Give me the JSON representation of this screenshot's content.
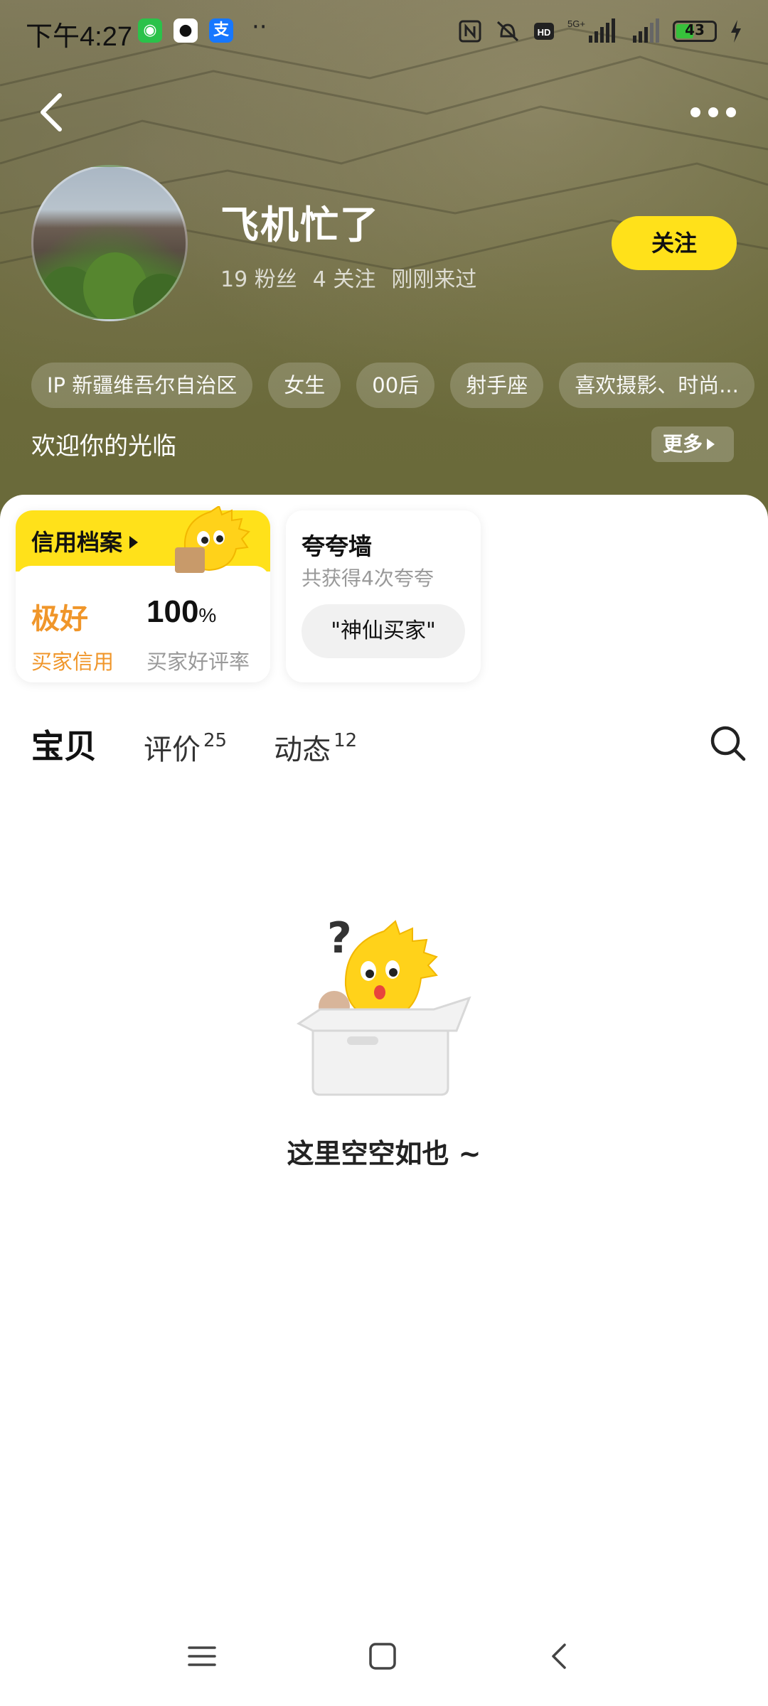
{
  "status_bar": {
    "time": "下午4:27",
    "apps": [
      "wechat-icon",
      "qq-icon",
      "alipay-icon"
    ],
    "network": "5G+",
    "battery": "43"
  },
  "profile": {
    "name": "飞机忙了",
    "followers": "19 粉丝",
    "following": "4 关注",
    "last_seen": "刚刚来过",
    "follow_label": "关注",
    "tags": [
      "IP 新疆维吾尔自治区",
      "女生",
      "00后",
      "射手座",
      "喜欢摄影、时尚..."
    ],
    "welcome": "欢迎你的光临",
    "more_label": "更多"
  },
  "credit": {
    "title": "信用档案",
    "level": "极好",
    "level_label": "买家信用",
    "rate": "100",
    "rate_unit": "%",
    "rate_label": "买家好评率"
  },
  "praise": {
    "title": "夸夸墙",
    "subtitle": "共获得4次夸夸",
    "badge": "\"神仙买家\""
  },
  "tabs": [
    {
      "label": "宝贝",
      "count": ""
    },
    {
      "label": "评价",
      "count": "25"
    },
    {
      "label": "动态",
      "count": "12"
    }
  ],
  "empty": {
    "message": "这里空空如也 ~"
  },
  "colors": {
    "accent": "#ffe11a",
    "credit_orange": "#f0962a",
    "cover_olive": "#6c6b3c"
  }
}
